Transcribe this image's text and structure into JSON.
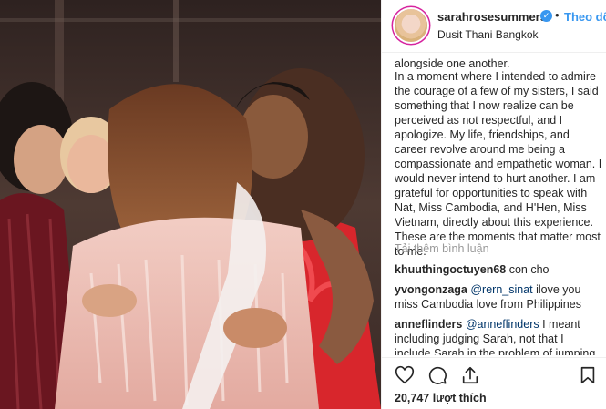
{
  "post": {
    "username": "sarahrosesummers",
    "verified_glyph": "✓",
    "separator": "•",
    "follow_label": "Theo dõi",
    "location": "Dusit Thani Bangkok",
    "caption_lead": "alongside one another.",
    "caption_body": "In a moment where I intended to admire the courage of a few of my sisters, I said something that I now realize can be perceived as not respectful, and I apologize. My life, friendships, and career revolve around me being a compassionate and empathetic woman. I would never intend to hurt another. I am grateful for opportunities to speak with Nat, Miss Cambodia, and H'Hen, Miss Vietnam, directly about this experience. These are the moments that matter most to me.",
    "load_more": "Tải thêm bình luận",
    "likes": "20,747 lượt thích"
  },
  "comments": [
    {
      "user": "khuuthingoctuyen68",
      "mention": "",
      "text": "con cho"
    },
    {
      "user": "yvongonzaga",
      "mention": "@rern_sinat",
      "text": "ilove you miss Cambodia love from Philippines"
    },
    {
      "user": "anneflinders",
      "mention": "@anneflinders",
      "text": "I meant including judging Sarah, not that I include Sarah in the problem of jumping to"
    }
  ],
  "icons": {
    "like": "heart-icon",
    "comment": "comment-bubble-icon",
    "share": "share-icon",
    "save": "bookmark-icon"
  },
  "colors": {
    "link_blue": "#3897f0",
    "mention_blue": "#003569",
    "muted": "#999999",
    "text": "#262626"
  }
}
